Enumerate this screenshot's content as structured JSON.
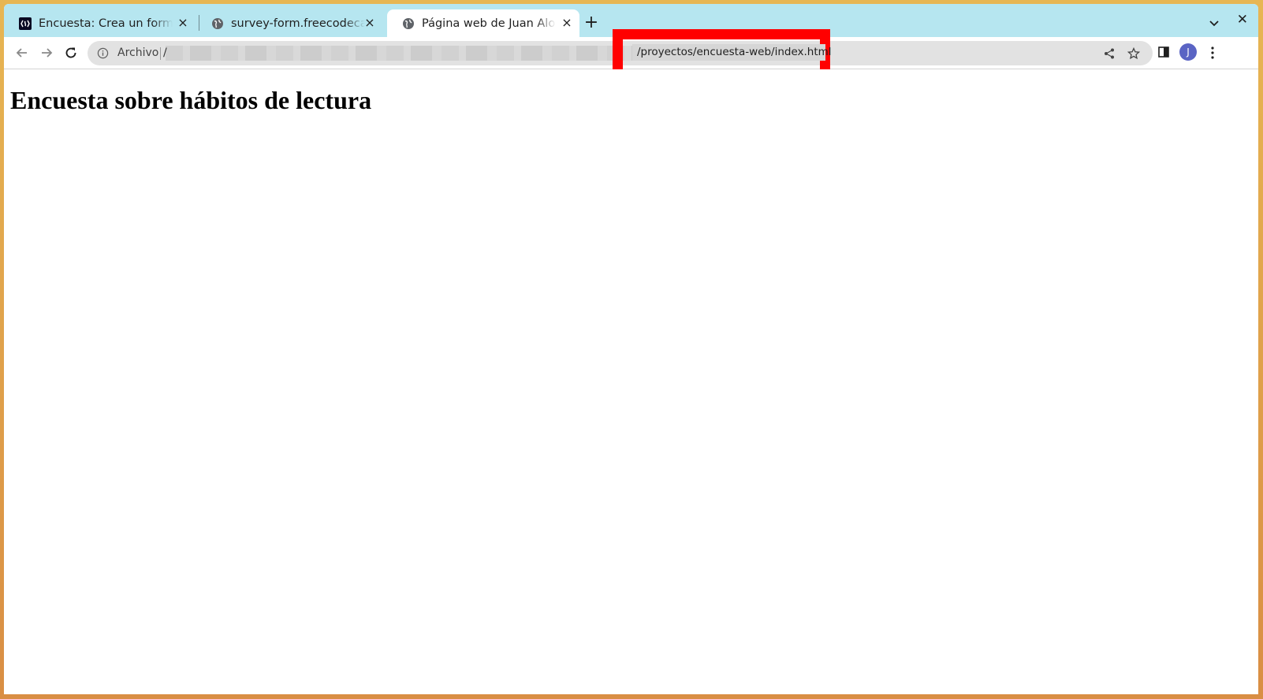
{
  "browser": {
    "tabs": [
      {
        "title": "Encuesta: Crea un formulario",
        "favicon": "freecodecamp-icon",
        "active": false
      },
      {
        "title": "survey-form.freecodecamp.rocks",
        "favicon": "globe-icon",
        "active": false
      },
      {
        "title": "Página web de Juan Alonso",
        "favicon": "globe-icon",
        "active": true
      }
    ],
    "new_tab_label": "+",
    "close_symbol": "×",
    "window_close_symbol": "✕"
  },
  "toolbar": {
    "omnibox_label": "Archivo",
    "url_prefix": "/",
    "url_path": "/proyectos/encuesta-web/index.html",
    "avatar_letter": "J"
  },
  "highlight_color": "#ff0000",
  "page": {
    "heading": "Encuesta sobre hábitos de lectura"
  }
}
